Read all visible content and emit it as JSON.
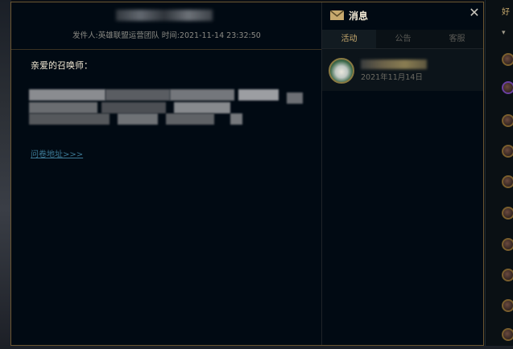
{
  "mail": {
    "meta": "发件人:英雄联盟运营团队  时间:2021-11-14 23:32:50",
    "greeting": "亲爱的召唤师：",
    "link": "问卷地址>>>"
  },
  "messages": {
    "title": "消息",
    "close_icon": "close-icon",
    "tabs": [
      {
        "label": "活动",
        "active": true
      },
      {
        "label": "公告",
        "active": false
      },
      {
        "label": "客服",
        "active": false
      }
    ],
    "items": [
      {
        "date": "2021年11月14日"
      }
    ]
  },
  "friends": {
    "header": "好",
    "dropdown": "▾"
  },
  "colors": {
    "accent_gold": "#c8aa6e",
    "border_gold": "#6b5631",
    "window_bg": "#010a13",
    "link": "#3d7a96"
  }
}
